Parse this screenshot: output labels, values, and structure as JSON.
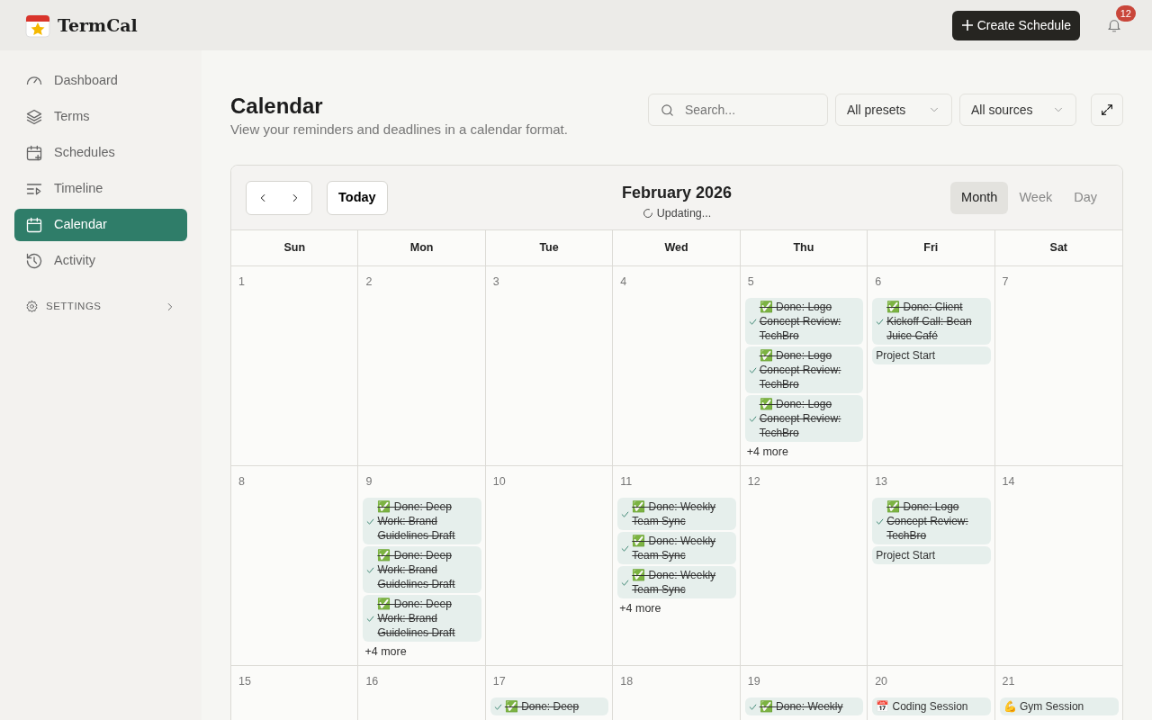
{
  "app": {
    "name": "TermCal"
  },
  "header": {
    "create_button": "Create Schedule",
    "notifications": "12"
  },
  "sidebar": {
    "items": [
      {
        "label": "Dashboard",
        "selected": false
      },
      {
        "label": "Terms",
        "selected": false
      },
      {
        "label": "Schedules",
        "selected": false
      },
      {
        "label": "Timeline",
        "selected": false
      },
      {
        "label": "Calendar",
        "selected": true
      },
      {
        "label": "Activity",
        "selected": false
      }
    ],
    "settings": "SETTINGS"
  },
  "page": {
    "title": "Calendar",
    "subtitle": "View your reminders and deadlines in a calendar format."
  },
  "filters": {
    "search_placeholder": "Search...",
    "presets": "All presets",
    "sources": "All sources"
  },
  "calendar": {
    "month": "February 2026",
    "status": "Updating...",
    "today": "Today",
    "views": [
      {
        "label": "Month",
        "selected": true
      },
      {
        "label": "Week",
        "selected": false
      },
      {
        "label": "Day",
        "selected": false
      }
    ],
    "weekdays": [
      "Sun",
      "Mon",
      "Tue",
      "Wed",
      "Thu",
      "Fri",
      "Sat"
    ],
    "weeks": [
      [
        {
          "day": "1"
        },
        {
          "day": "2"
        },
        {
          "day": "3"
        },
        {
          "day": "4"
        },
        {
          "day": "5",
          "events": [
            {
              "text": "✅ Done: Logo Concept Review: TechBro",
              "done": true
            },
            {
              "text": "✅ Done: Logo Concept Review: TechBro",
              "done": true
            },
            {
              "text": "✅ Done: Logo Concept Review: TechBro",
              "done": true
            }
          ],
          "more": "+4 more"
        },
        {
          "day": "6",
          "events": [
            {
              "text": "✅ Done: Client Kickoff Call: Bean Juice Café",
              "done": true
            },
            {
              "text": "Project Start",
              "done": false
            }
          ]
        },
        {
          "day": "7"
        }
      ],
      [
        {
          "day": "8"
        },
        {
          "day": "9",
          "events": [
            {
              "text": "✅ Done: Deep Work: Brand Guidelines Draft",
              "done": true
            },
            {
              "text": "✅ Done: Deep Work: Brand Guidelines Draft",
              "done": true
            },
            {
              "text": "✅ Done: Deep Work: Brand Guidelines Draft",
              "done": true
            }
          ],
          "more": "+4 more"
        },
        {
          "day": "10"
        },
        {
          "day": "11",
          "events": [
            {
              "text": "✅ Done: Weekly Team Sync",
              "done": true
            },
            {
              "text": "✅ Done: Weekly Team Sync",
              "done": true
            },
            {
              "text": "✅ Done: Weekly Team Sync",
              "done": true
            }
          ],
          "more": "+4 more"
        },
        {
          "day": "12"
        },
        {
          "day": "13",
          "events": [
            {
              "text": "✅ Done: Logo Concept Review: TechBro",
              "done": true
            },
            {
              "text": "Project Start",
              "done": false
            }
          ]
        },
        {
          "day": "14"
        }
      ],
      [
        {
          "day": "15"
        },
        {
          "day": "16"
        },
        {
          "day": "17",
          "events": [
            {
              "text": "✅ Done: Deep",
              "done": true
            }
          ]
        },
        {
          "day": "18"
        },
        {
          "day": "19",
          "events": [
            {
              "text": "✅ Done: Weekly",
              "done": true
            }
          ]
        },
        {
          "day": "20",
          "events": [
            {
              "text": "📅 Coding Session",
              "done": false
            }
          ]
        },
        {
          "day": "21",
          "events": [
            {
              "text": "💪 Gym Session",
              "done": false
            }
          ]
        }
      ]
    ]
  }
}
